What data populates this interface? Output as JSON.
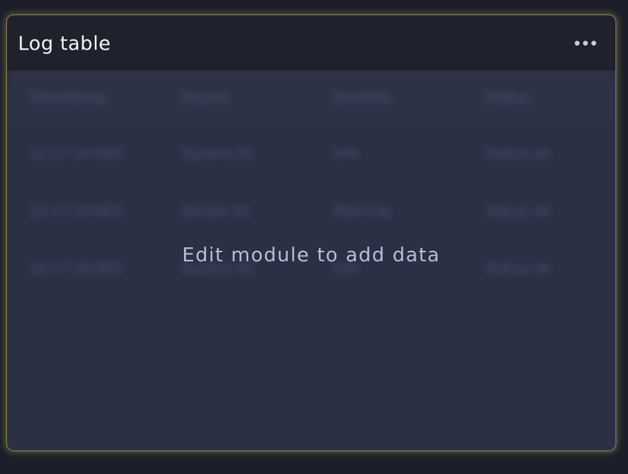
{
  "module": {
    "title": "Log table",
    "more_icon": "more-horizontal-icon",
    "empty_message": "Edit module to add data"
  },
  "placeholder_table": {
    "columns": [
      "Timestamp",
      "Source",
      "Severity",
      "Status"
    ],
    "rows": [
      [
        "12:17:14:003",
        "System 01",
        "Info",
        "Status ok"
      ],
      [
        "12:17:14:003",
        "Sensor 01",
        "Warning",
        "Status ok"
      ],
      [
        "12:17:14:003",
        "System 01",
        "Info",
        "Status ok"
      ]
    ]
  },
  "colors": {
    "background": "#1c1e2a",
    "panel": "#2b3045",
    "header": "#1f212d",
    "highlight_glow": "#c8c85a"
  }
}
